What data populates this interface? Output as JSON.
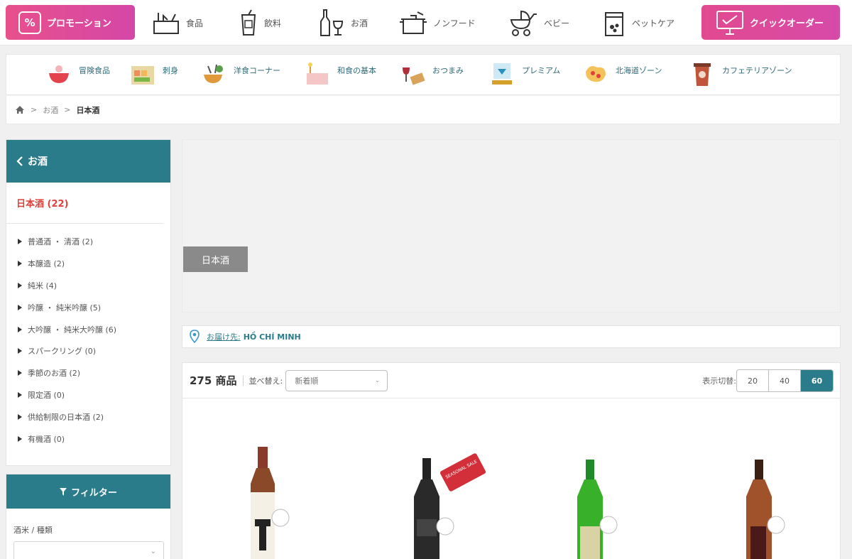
{
  "top_nav": {
    "promotion": "プロモーション",
    "items": [
      {
        "label": "食品",
        "icon": "cooking-icon"
      },
      {
        "label": "飲料",
        "icon": "drink-cup-icon"
      },
      {
        "label": "お酒",
        "icon": "wine-bottle-icon"
      },
      {
        "label": "ノンフード",
        "icon": "pot-icon"
      },
      {
        "label": "ベビー",
        "icon": "stroller-icon"
      },
      {
        "label": "ペットケア",
        "icon": "pet-food-bag-icon"
      }
    ],
    "quick_order": "クイックオーダー"
  },
  "sub_nav": {
    "items": [
      {
        "label": "冒険食品",
        "icon": "bowl-icon"
      },
      {
        "label": "刺身",
        "icon": "sashimi-icon"
      },
      {
        "label": "洋食コーナー",
        "icon": "western-food-icon"
      },
      {
        "label": "和食の基本",
        "icon": "japanese-food-icon"
      },
      {
        "label": "おつまみ",
        "icon": "snack-icon"
      },
      {
        "label": "プレミアム",
        "icon": "premium-diamond-icon"
      },
      {
        "label": "北海道ゾーン",
        "icon": "hokkaido-icon"
      },
      {
        "label": "カフェテリアゾーン",
        "icon": "coffee-cup-icon"
      }
    ]
  },
  "breadcrumb": {
    "home_icon": "home-icon",
    "separator": ">",
    "level1": "お酒",
    "current": "日本酒"
  },
  "sidebar": {
    "back_title": "お酒",
    "current_category": "日本酒 (22)",
    "items": [
      "普通酒 ・ 清酒 (2)",
      "本醸造 (2)",
      "純米 (4)",
      "吟醸 ・ 純米吟醸 (5)",
      "大吟醸 ・ 純米大吟醸 (6)",
      "スパークリング (0)",
      "季節のお酒 (2)",
      "限定酒 (0)",
      "供給制限の日本酒 (2)",
      "有機酒 (0)"
    ],
    "filter_title": "フィルター",
    "filter_label": "酒米 / 種類"
  },
  "banner": {
    "tag": "日本酒"
  },
  "delivery": {
    "label": "お届け先:",
    "location": "HỒ CHÍ MINH"
  },
  "products": {
    "count": "275 商品",
    "sort_label": "並べ替え:",
    "sort_value": "新着順",
    "per_page_label": "表示切替:",
    "per_page_options": [
      "20",
      "40",
      "60"
    ],
    "per_page_selected": "60",
    "sale_tag": "SEASONAL SALE"
  },
  "colors": {
    "accent_teal": "#2a7c8a",
    "promo_pink": "#e24a90",
    "category_red": "#e0413a"
  }
}
